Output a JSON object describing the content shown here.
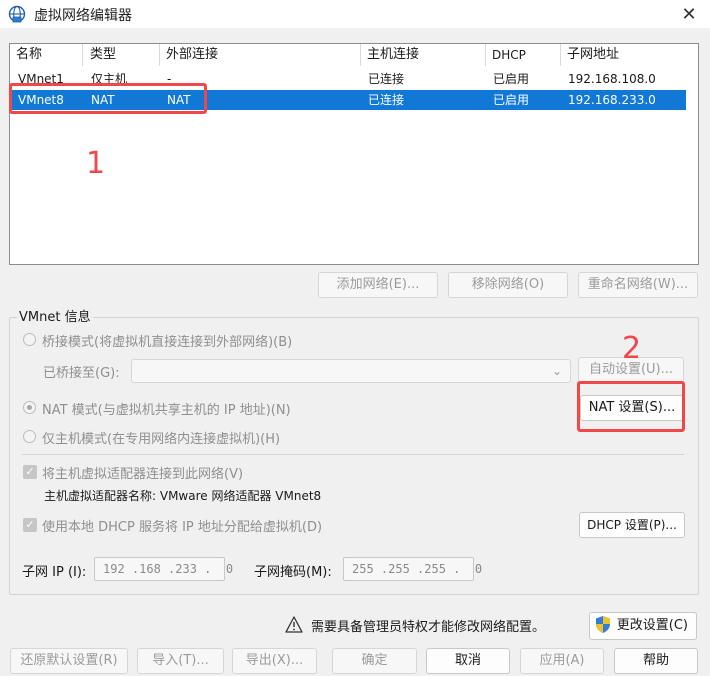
{
  "window": {
    "title": "虚拟网络编辑器",
    "close_glyph": "✕",
    "app_icon": "vmware-network-icon"
  },
  "table": {
    "headers": [
      "名称",
      "类型",
      "外部连接",
      "主机连接",
      "DHCP",
      "子网地址"
    ],
    "rows": [
      {
        "name": "VMnet1",
        "type": "仅主机",
        "external": "-",
        "host": "已连接",
        "dhcp": "已启用",
        "subnet": "192.168.108.0",
        "selected": false
      },
      {
        "name": "VMnet8",
        "type": "NAT",
        "external": "NAT",
        "host": "已连接",
        "dhcp": "已启用",
        "subnet": "192.168.233.0",
        "selected": true
      }
    ]
  },
  "table_buttons": {
    "add": "添加网络(E)...",
    "remove": "移除网络(O)",
    "rename": "重命名网络(W)..."
  },
  "vmnet_info": {
    "group_label": "VMnet 信息",
    "bridged_label": "桥接模式(将虚拟机直接连接到外部网络)(B)",
    "bridged_to_label": "已桥接至(G):",
    "auto_button": "自动设置(U)...",
    "nat_label": "NAT 模式(与虚拟机共享主机的 IP 地址)(N)",
    "nat_button": "NAT 设置(S)...",
    "hostonly_label": "仅主机模式(在专用网络内连接虚拟机)(H)",
    "connect_adapter_label": "将主机虚拟适配器连接到此网络(V)",
    "adapter_name_label": "主机虚拟适配器名称: VMware 网络适配器 VMnet8",
    "dhcp_label": "使用本地 DHCP 服务将 IP 地址分配给虚拟机(D)",
    "dhcp_button": "DHCP 设置(P)...",
    "subnet_ip_label": "子网 IP (I):",
    "subnet_ip_value": "192 .168 .233 .  0",
    "subnet_mask_label": "子网掩码(M):",
    "subnet_mask_value": "255 .255 .255 .  0"
  },
  "admin_notice": {
    "text": "需要具备管理员特权才能修改网络配置。",
    "change_button": "更改设置(C)"
  },
  "footer_buttons": {
    "restore": "还原默认设置(R)",
    "import": "导入(T)...",
    "export": "导出(X)...",
    "ok": "确定",
    "cancel": "取消",
    "apply": "应用(A)",
    "help": "帮助"
  },
  "annotations": {
    "first": "1",
    "second": "2",
    "color": "#f0474b"
  },
  "colors": {
    "selection": "#1178d6",
    "annotation": "#f0474b"
  }
}
